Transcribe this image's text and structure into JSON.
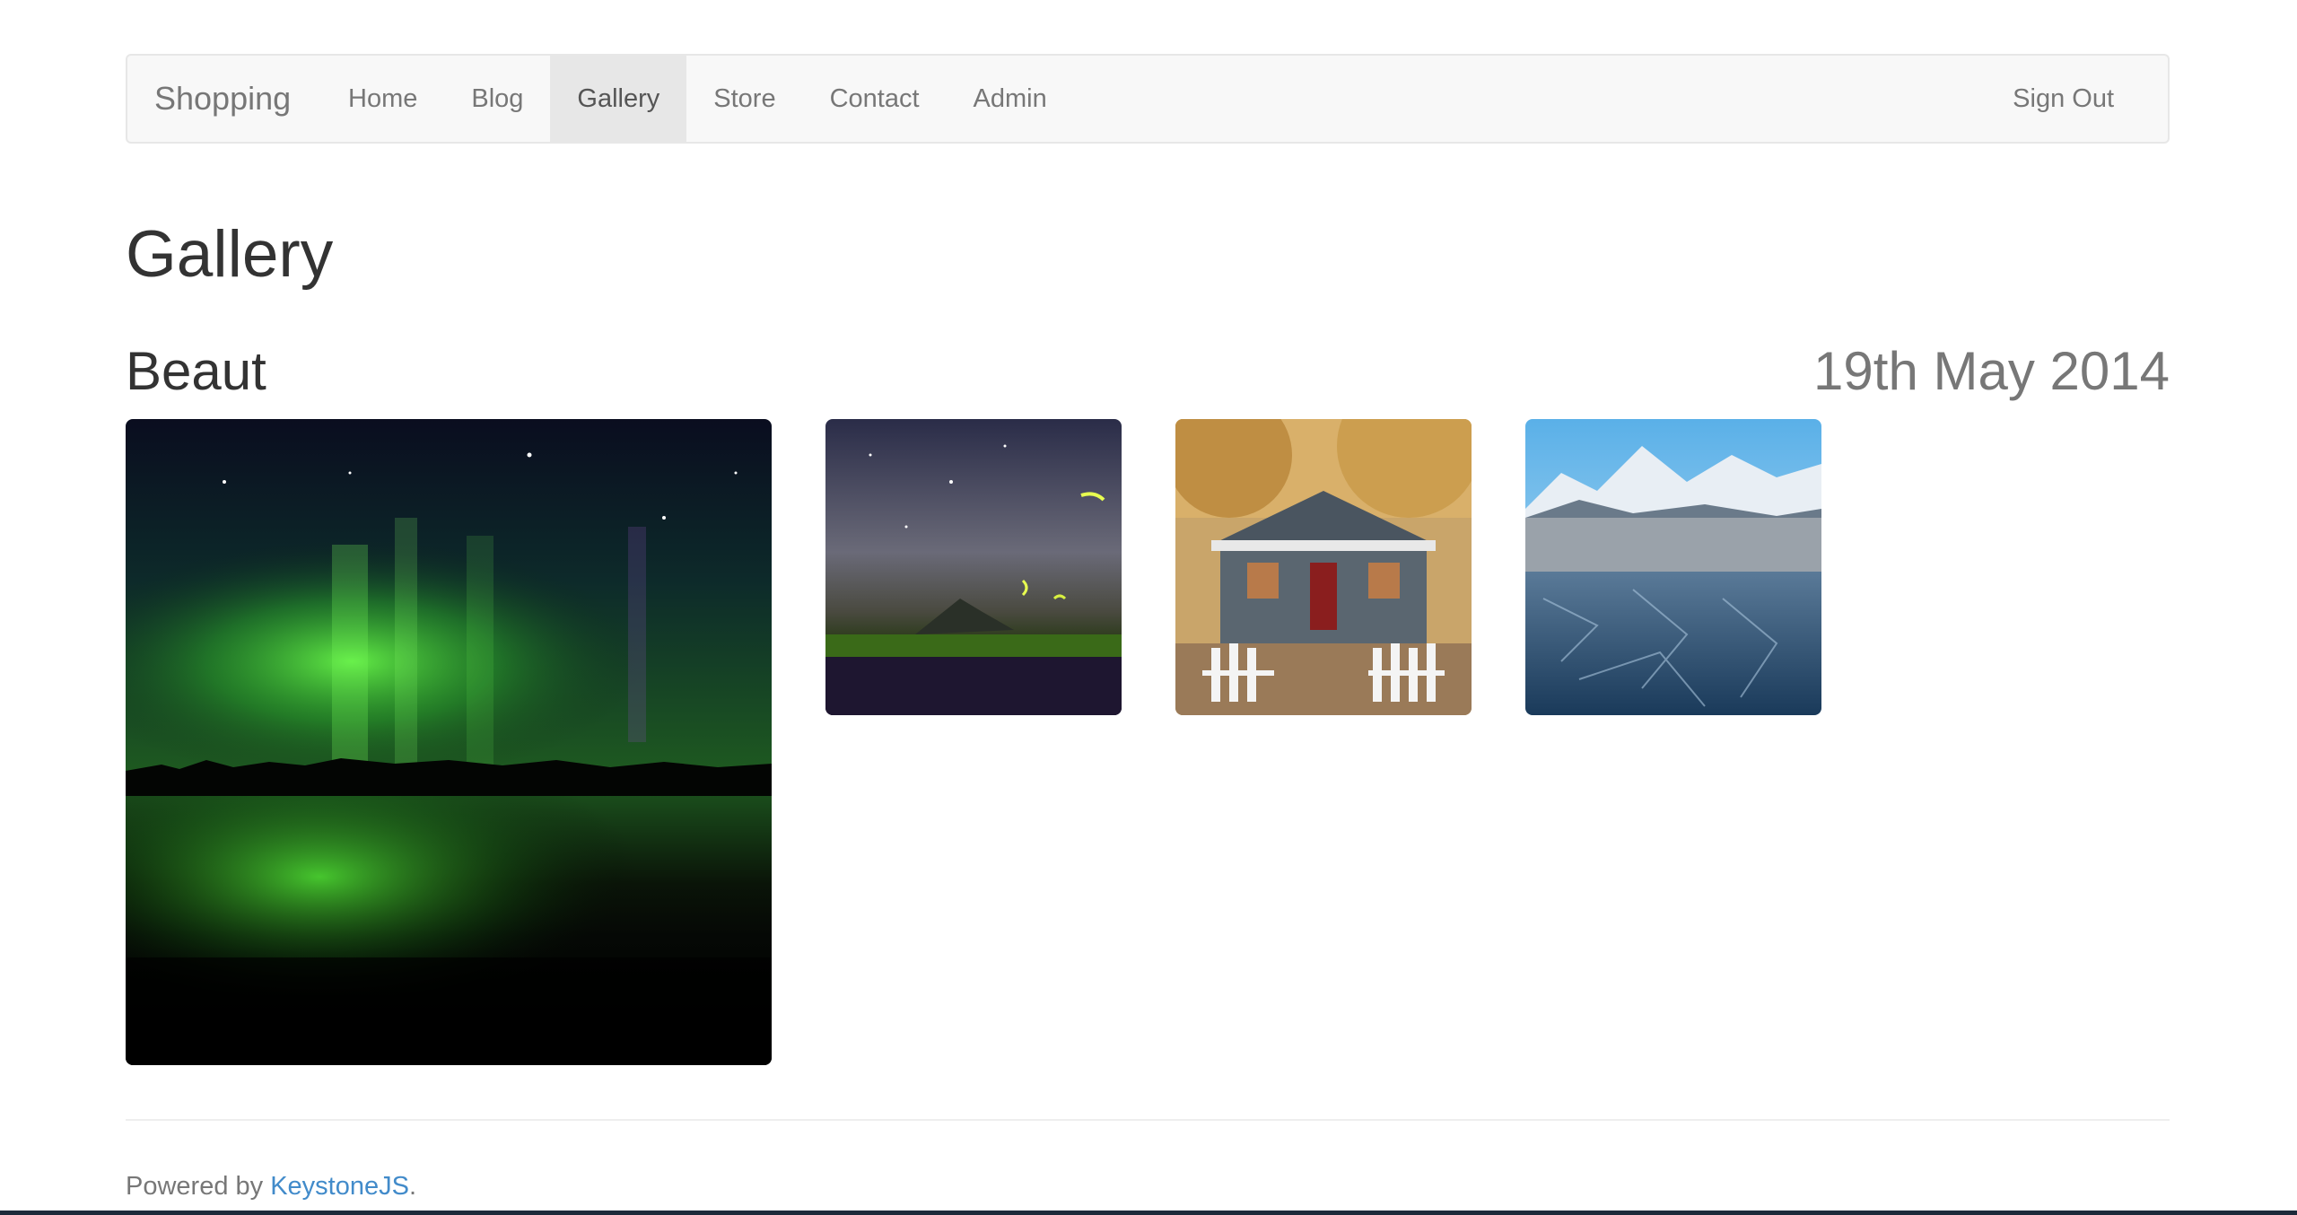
{
  "navbar": {
    "brand": "Shopping",
    "items": [
      {
        "label": "Home"
      },
      {
        "label": "Blog"
      },
      {
        "label": "Gallery",
        "active": true
      },
      {
        "label": "Store"
      },
      {
        "label": "Contact"
      },
      {
        "label": "Admin"
      }
    ],
    "sign_out": "Sign Out"
  },
  "page": {
    "title": "Gallery"
  },
  "gallery": {
    "name": "Beaut",
    "date": "19th May 2014",
    "images": [
      {
        "name": "aurora-image"
      },
      {
        "name": "milky-way-fireflies-image"
      },
      {
        "name": "house-with-picket-fence-image"
      },
      {
        "name": "ice-lake-mountains-image"
      }
    ]
  },
  "footer": {
    "prefix": "Powered by ",
    "link": "KeystoneJS",
    "suffix": "."
  },
  "colors": {
    "link": "#428bca",
    "muted": "#777777",
    "navbar_bg": "#f8f8f8",
    "active_bg": "#e7e7e7"
  }
}
